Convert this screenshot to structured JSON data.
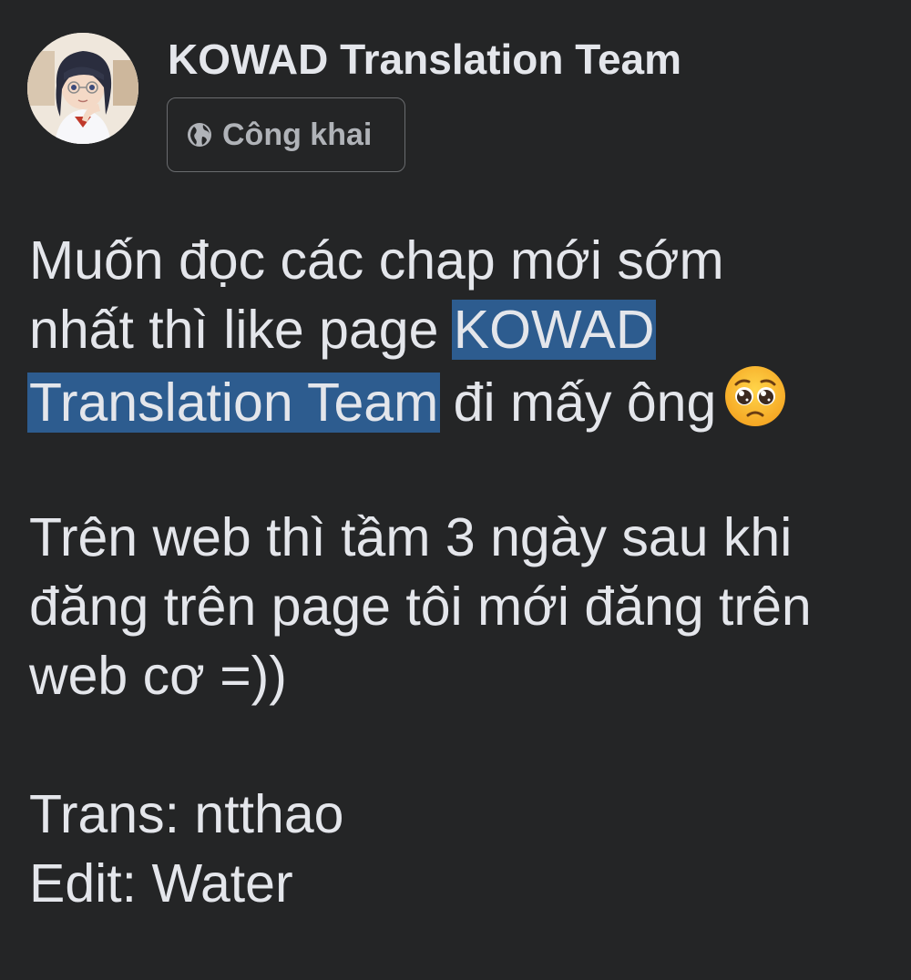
{
  "author": {
    "name": "KOWAD Translation Team",
    "avatar_icon": "avatar-anime-girl"
  },
  "privacy": {
    "icon": "globe-icon",
    "label": "Công khai"
  },
  "post": {
    "p1": {
      "line1": "Muốn đọc các chap mới sớm",
      "line2_pre": "nhất thì like page ",
      "line2_link": "KOWAD",
      "line3_link": "Translation Team",
      "line3_post": " đi mấy ông",
      "emoji": "pleading-face-emoji"
    },
    "p2": {
      "line1": "Trên web thì tầm 3 ngày sau khi",
      "line2": "đăng trên page tôi mới đăng trên",
      "line3": "web cơ =))"
    },
    "p3": {
      "line1": "Trans: ntthao",
      "line2": "Edit: Water"
    }
  },
  "colors": {
    "background": "#242526",
    "text": "#e4e6eb",
    "secondary_text": "#b0b3b8",
    "link_highlight": "#2d5c8f"
  }
}
